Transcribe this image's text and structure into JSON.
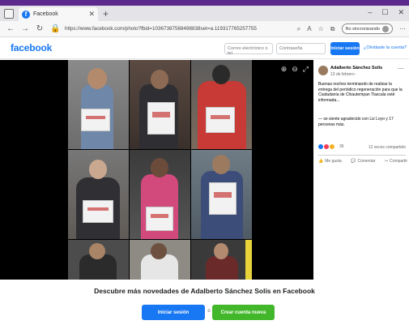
{
  "browser": {
    "tab_title": "Facebook",
    "url": "https://www.facebook.com/photo?fbid=10367387568498838set=a.119317765257755",
    "sync_label": "No sincronizando"
  },
  "header": {
    "logo": "facebook",
    "email_placeholder": "Correo electrónico o tel",
    "password_placeholder": "Contraseña",
    "login_label": "Iniciar sesión",
    "forgot_label": "¿Olvidaste la cuenta?"
  },
  "post": {
    "author": "Adalberto Sánchez Solís",
    "date": "13 de febrero ·",
    "text": "Buenas noches terminando de realizar la entrega del periódico regeneración para que la Ciudadanía de Chiautempan Tlaxcala esté informada...",
    "feeling": "— se siente agradecido con Liz Loyo y 17 personas más.",
    "reaction_count": "36",
    "shares": "12 veces compartido",
    "like_label": "Me gusta",
    "comment_label": "Comentar",
    "share_label": "Compartir"
  },
  "banner": {
    "title": "Descubre más novedades de Adalberto Sánchez Solís en Facebook",
    "login_label": "Iniciar sesión",
    "or_label": "o",
    "create_label": "Crear cuenta nueva"
  },
  "colors": {
    "brand": "#1877f2",
    "create": "#42b72a"
  }
}
